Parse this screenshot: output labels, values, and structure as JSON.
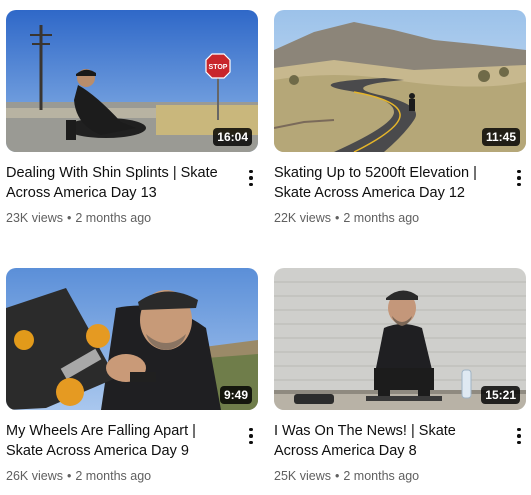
{
  "videos": [
    {
      "title": "Dealing With Shin Splints | Skate Across America Day 13",
      "duration": "16:04",
      "views": "23K views",
      "age": "2 months ago",
      "thumbnail": "man-stretching-by-road-with-stop-sign"
    },
    {
      "title": "Skating Up to 5200ft Elevation | Skate Across America Day 12",
      "duration": "11:45",
      "views": "22K views",
      "age": "2 months ago",
      "thumbnail": "skater-on-winding-desert-road"
    },
    {
      "title": "My Wheels Are Falling Apart | Skate Across America Day 9",
      "duration": "9:49",
      "views": "26K views",
      "age": "2 months ago",
      "thumbnail": "man-inspecting-skateboard-wheel"
    },
    {
      "title": "I Was On The News! | Skate Across America Day 8",
      "duration": "15:21",
      "views": "25K views",
      "age": "2 months ago",
      "thumbnail": "man-sitting-by-brick-wall"
    }
  ],
  "separator": "•",
  "stop_sign_text": "STOP"
}
